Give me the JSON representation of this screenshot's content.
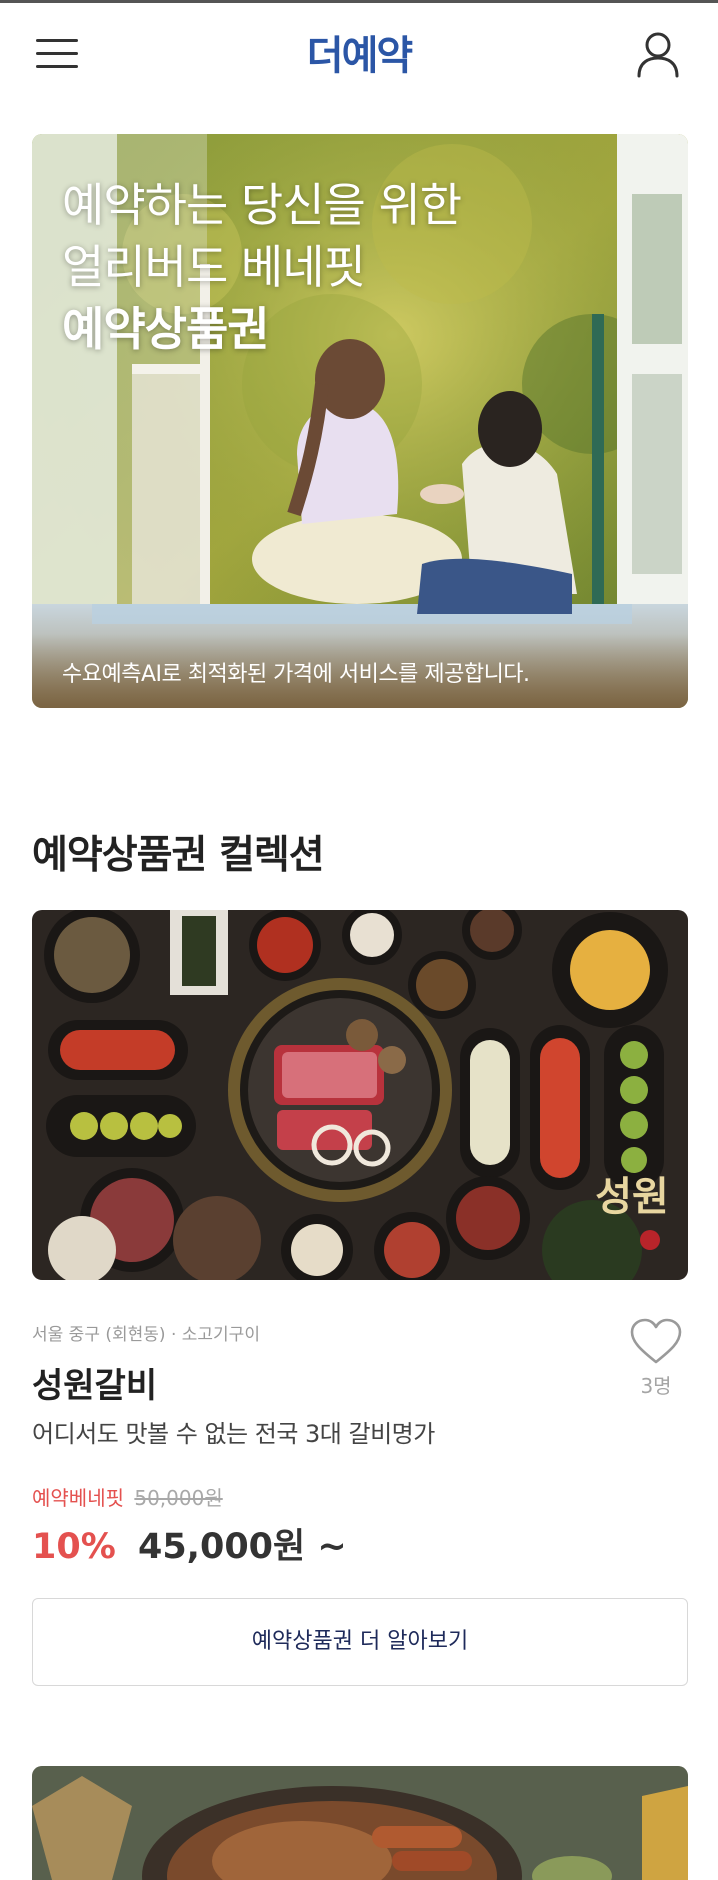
{
  "header": {
    "logo": "더예약",
    "menu_icon": "hamburger-menu-icon",
    "user_icon": "user-icon"
  },
  "banner": {
    "title_line1": "예약하는 당신을 위한",
    "title_line2": "얼리버드 베네핏",
    "title_line3": "예약상품권",
    "caption": "수요예측AI로 최적화된 가격에 서비스를 제공합니다."
  },
  "collection": {
    "title": "예약상품권 컬렉션",
    "card": {
      "meta": "서울 중구 (회현동) · 소고기구이",
      "name": "성원갈비",
      "description": "어디서도 맛볼 수 없는 전국 3대 갈비명가",
      "like_icon": "heart-icon",
      "like_count": "3명",
      "benefit_label": "예약베네핏",
      "original_price": "50,000원",
      "discount": "10%",
      "price": "45,000원 ~",
      "more_button": "예약상품권 더 알아보기",
      "brand_mark": "성원"
    }
  },
  "colors": {
    "logo": "#2b56a6",
    "accent_red": "#e4514f",
    "button_text": "#1e2a5a"
  }
}
